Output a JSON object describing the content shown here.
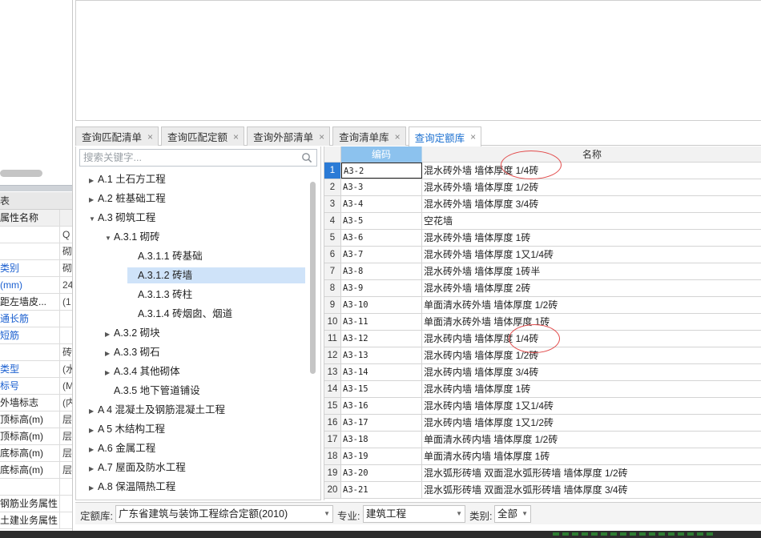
{
  "left_panel": {
    "title": "表",
    "header": {
      "name": "属性名称",
      "value": ""
    },
    "rows": [
      {
        "name": "",
        "value": "Q",
        "blue": true
      },
      {
        "name": "",
        "value": "砌",
        "blue": false
      },
      {
        "name": "类别",
        "value": "砌",
        "blue": true
      },
      {
        "name": "(mm)",
        "value": "24",
        "blue": true
      },
      {
        "name": "距左墙皮...",
        "value": "(1",
        "blue": false
      },
      {
        "name": "通长筋",
        "value": "",
        "blue": true
      },
      {
        "name": "短筋",
        "value": "",
        "blue": true
      },
      {
        "name": "",
        "value": "砖",
        "blue": true
      },
      {
        "name": "类型",
        "value": "(水",
        "blue": true
      },
      {
        "name": "标号",
        "value": "(M",
        "blue": true
      },
      {
        "name": "外墙标志",
        "value": "(内",
        "blue": false
      },
      {
        "name": "顶标高(m)",
        "value": "层",
        "blue": false
      },
      {
        "name": "顶标高(m)",
        "value": "层",
        "blue": false
      },
      {
        "name": "底标高(m)",
        "value": "层",
        "blue": false
      },
      {
        "name": "底标高(m)",
        "value": "层",
        "blue": false
      },
      {
        "name": "",
        "value": "",
        "blue": false
      },
      {
        "name": "钢筋业务属性",
        "value": "",
        "blue": false
      },
      {
        "name": "土建业务属性",
        "value": "",
        "blue": false
      }
    ]
  },
  "tabs": [
    {
      "label": "查询匹配清单",
      "active": false
    },
    {
      "label": "查询匹配定额",
      "active": false
    },
    {
      "label": "查询外部清单",
      "active": false
    },
    {
      "label": "查询清单库",
      "active": false
    },
    {
      "label": "查询定额库",
      "active": true
    }
  ],
  "tab_close_glyph": "×",
  "search": {
    "placeholder": "搜索关键字..."
  },
  "tree": [
    {
      "label": "A.1 土石方工程",
      "level": 0,
      "arrow": "▶"
    },
    {
      "label": "A.2 桩基础工程",
      "level": 0,
      "arrow": "▶"
    },
    {
      "label": "A.3 砌筑工程",
      "level": 0,
      "arrow": "▼"
    },
    {
      "label": "A.3.1 砌砖",
      "level": 1,
      "arrow": "▼"
    },
    {
      "label": "A.3.1.1 砖基础",
      "level": 2,
      "arrow": ""
    },
    {
      "label": "A.3.1.2 砖墙",
      "level": 2,
      "arrow": "",
      "selected": true
    },
    {
      "label": "A.3.1.3 砖柱",
      "level": 2,
      "arrow": ""
    },
    {
      "label": "A.3.1.4 砖烟囱、烟道",
      "level": 2,
      "arrow": ""
    },
    {
      "label": "A.3.2 砌块",
      "level": 1,
      "arrow": "▶"
    },
    {
      "label": "A.3.3 砌石",
      "level": 1,
      "arrow": "▶"
    },
    {
      "label": "A.3.4 其他砌体",
      "level": 1,
      "arrow": "▶"
    },
    {
      "label": "A.3.5 地下管道铺设",
      "level": 1,
      "arrow": ""
    },
    {
      "label": "A 4 混凝土及钢筋混凝土工程",
      "level": 0,
      "arrow": "▶"
    },
    {
      "label": "A 5 木结构工程",
      "level": 0,
      "arrow": "▶"
    },
    {
      "label": "A.6 金属工程",
      "level": 0,
      "arrow": "▶"
    },
    {
      "label": "A.7 屋面及防水工程",
      "level": 0,
      "arrow": "▶"
    },
    {
      "label": "A.8 保温隔热工程",
      "level": 0,
      "arrow": "▶"
    }
  ],
  "grid": {
    "headers": {
      "code": "编码",
      "name": "名称"
    },
    "rows": [
      {
        "num": "1",
        "code": "A3-2",
        "name": "混水砖外墙 墙体厚度 1/4砖"
      },
      {
        "num": "2",
        "code": "A3-3",
        "name": "混水砖外墙 墙体厚度 1/2砖"
      },
      {
        "num": "3",
        "code": "A3-4",
        "name": "混水砖外墙 墙体厚度 3/4砖"
      },
      {
        "num": "4",
        "code": "A3-5",
        "name": "空花墙"
      },
      {
        "num": "5",
        "code": "A3-6",
        "name": "混水砖外墙 墙体厚度 1砖"
      },
      {
        "num": "6",
        "code": "A3-7",
        "name": "混水砖外墙 墙体厚度 1又1/4砖"
      },
      {
        "num": "7",
        "code": "A3-8",
        "name": "混水砖外墙 墙体厚度 1砖半"
      },
      {
        "num": "8",
        "code": "A3-9",
        "name": "混水砖外墙 墙体厚度 2砖"
      },
      {
        "num": "9",
        "code": "A3-10",
        "name": "单面清水砖外墙 墙体厚度 1/2砖"
      },
      {
        "num": "10",
        "code": "A3-11",
        "name": "单面清水砖外墙 墙体厚度 1砖"
      },
      {
        "num": "11",
        "code": "A3-12",
        "name": "混水砖内墙 墙体厚度 1/4砖"
      },
      {
        "num": "12",
        "code": "A3-13",
        "name": "混水砖内墙 墙体厚度 1/2砖"
      },
      {
        "num": "13",
        "code": "A3-14",
        "name": "混水砖内墙 墙体厚度 3/4砖"
      },
      {
        "num": "14",
        "code": "A3-15",
        "name": "混水砖内墙 墙体厚度 1砖"
      },
      {
        "num": "15",
        "code": "A3-16",
        "name": "混水砖内墙 墙体厚度 1又1/4砖"
      },
      {
        "num": "16",
        "code": "A3-17",
        "name": "混水砖内墙 墙体厚度 1又1/2砖"
      },
      {
        "num": "17",
        "code": "A3-18",
        "name": "单面清水砖内墙 墙体厚度 1/2砖"
      },
      {
        "num": "18",
        "code": "A3-19",
        "name": "单面清水砖内墙 墙体厚度 1砖"
      },
      {
        "num": "19",
        "code": "A3-20",
        "name": "混水弧形砖墙 双面混水弧形砖墙 墙体厚度 1/2砖"
      },
      {
        "num": "20",
        "code": "A3-21",
        "name": "混水弧形砖墙 双面混水弧形砖墙 墙体厚度 3/4砖"
      }
    ]
  },
  "filter": {
    "library_label": "定额库:",
    "library_value": "广东省建筑与装饰工程综合定额(2010)",
    "specialty_label": "专业:",
    "specialty_value": "建筑工程",
    "category_label": "类别:",
    "category_value": "全部"
  },
  "colors": {
    "accent": "#1a6fd0",
    "header_code": "#8cc2ee",
    "selection": "#cfe3f9",
    "annotation": "#e24b4b"
  }
}
